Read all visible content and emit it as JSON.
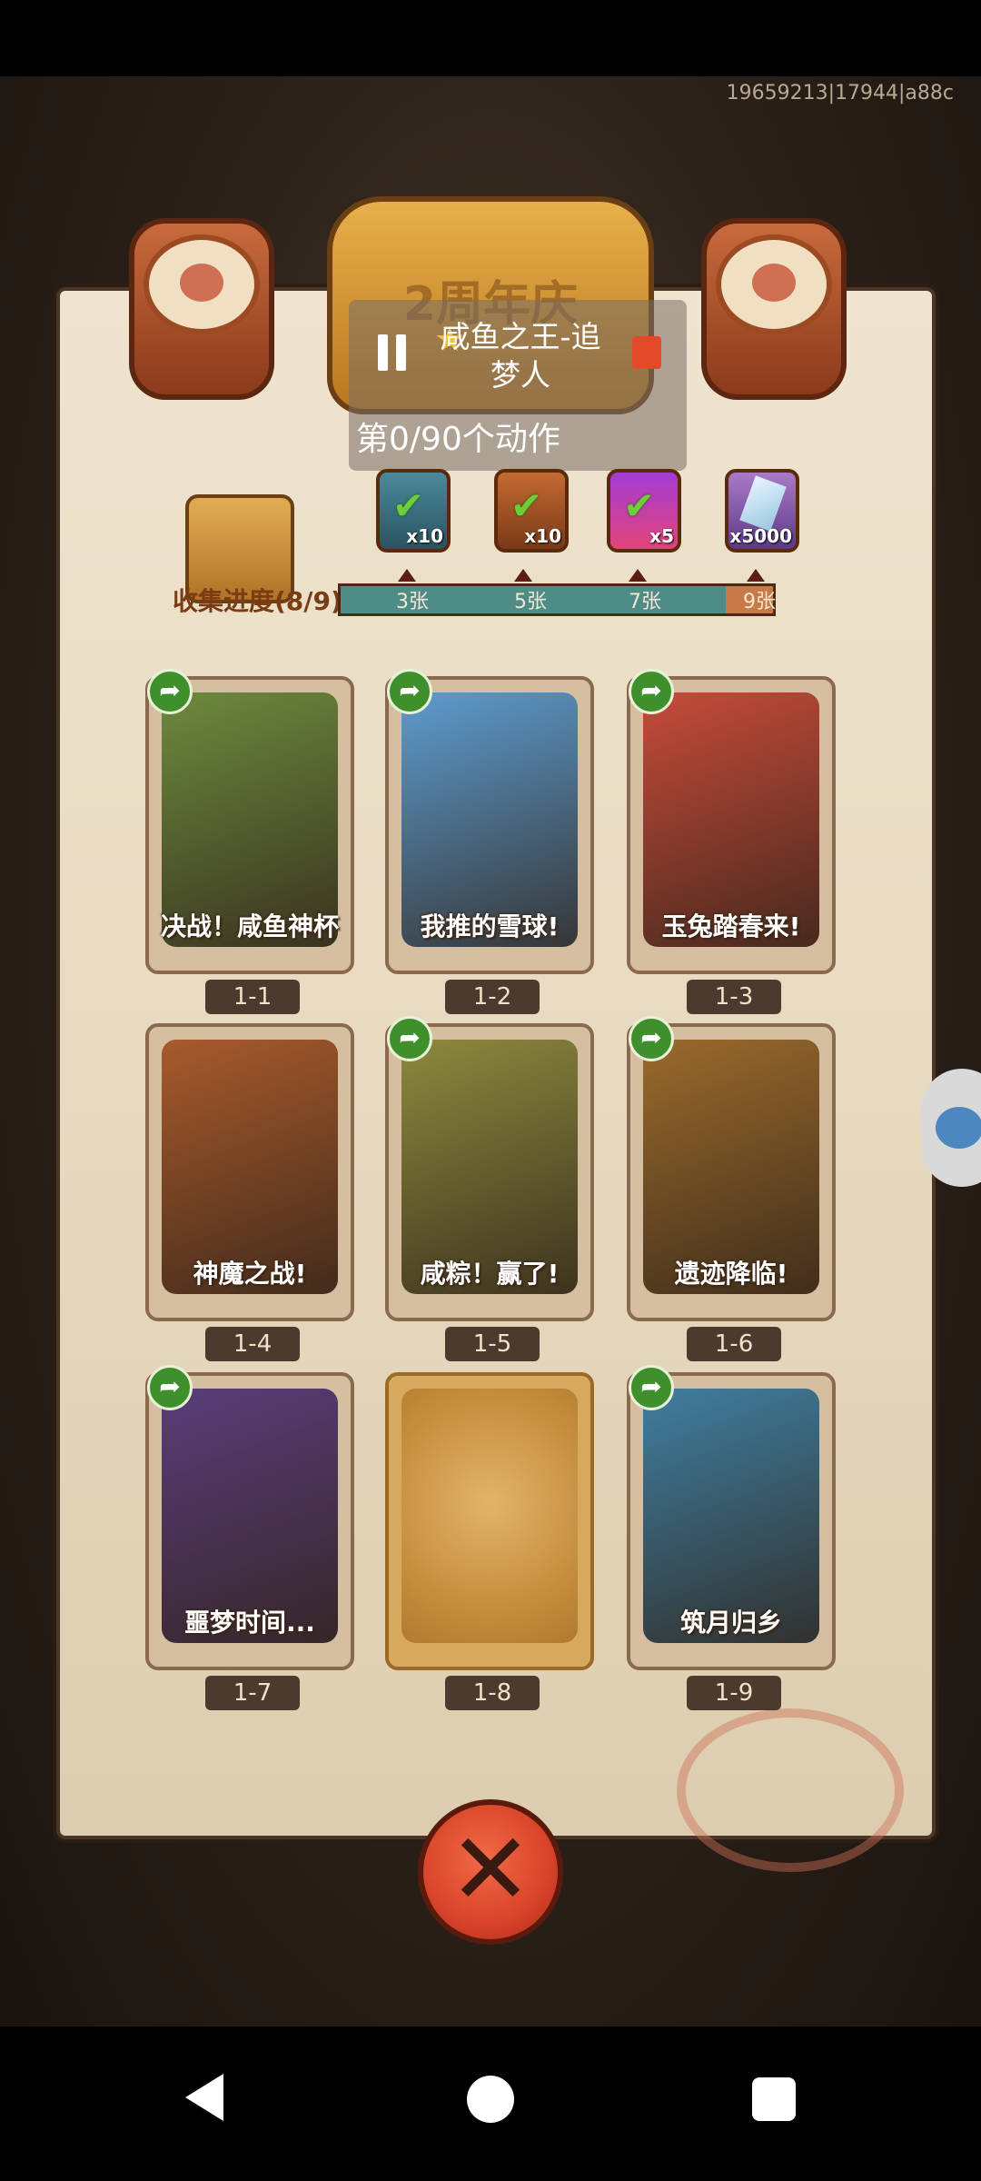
{
  "overlay": {
    "version_id": "19659213|17944|a88c"
  },
  "event": {
    "banner_title": "2周年庆"
  },
  "recorder": {
    "title": "咸鱼之王-追梦人",
    "status": "第0/90个动作"
  },
  "collection": {
    "progress_label": "收集进度(8/9)",
    "progress_fraction": 0.89,
    "rewards": [
      {
        "icon": "treasure-chest-icon",
        "qty": "x10",
        "claimed": true
      },
      {
        "icon": "scroll-icon",
        "qty": "x10",
        "claimed": true
      },
      {
        "icon": "orb-icon",
        "qty": "x5",
        "claimed": true
      },
      {
        "icon": "crystal-icon",
        "qty": "x5000",
        "claimed": false
      }
    ],
    "milestones": [
      "3张",
      "5张",
      "7张",
      "9张"
    ]
  },
  "cards": [
    {
      "caption": "决战！咸鱼神杯",
      "number": "1-1",
      "unlocked": true,
      "shareable": true,
      "color": "#6d8a3e"
    },
    {
      "caption": "我推的雪球!",
      "number": "1-2",
      "unlocked": true,
      "shareable": true,
      "color": "#5d9ccf"
    },
    {
      "caption": "玉兔踏春来!",
      "number": "1-3",
      "unlocked": true,
      "shareable": true,
      "color": "#c64b3a"
    },
    {
      "caption": "神魔之战!",
      "number": "1-4",
      "unlocked": true,
      "shareable": false,
      "color": "#a85a2c"
    },
    {
      "caption": "咸粽！赢了!",
      "number": "1-5",
      "unlocked": true,
      "shareable": true,
      "color": "#8c8a3e"
    },
    {
      "caption": "遗迹降临!",
      "number": "1-6",
      "unlocked": true,
      "shareable": true,
      "color": "#9a6a2c"
    },
    {
      "caption": "噩梦时间...",
      "number": "1-7",
      "unlocked": true,
      "shareable": true,
      "color": "#5a3d7a"
    },
    {
      "caption": "",
      "number": "1-8",
      "unlocked": false,
      "shareable": false,
      "color": "#d7a95e"
    },
    {
      "caption": "筑月归乡",
      "number": "1-9",
      "unlocked": true,
      "shareable": true,
      "color": "#3f7ea0"
    }
  ],
  "share_icon": "share-arrow-icon",
  "close_icon": "close-x-icon"
}
